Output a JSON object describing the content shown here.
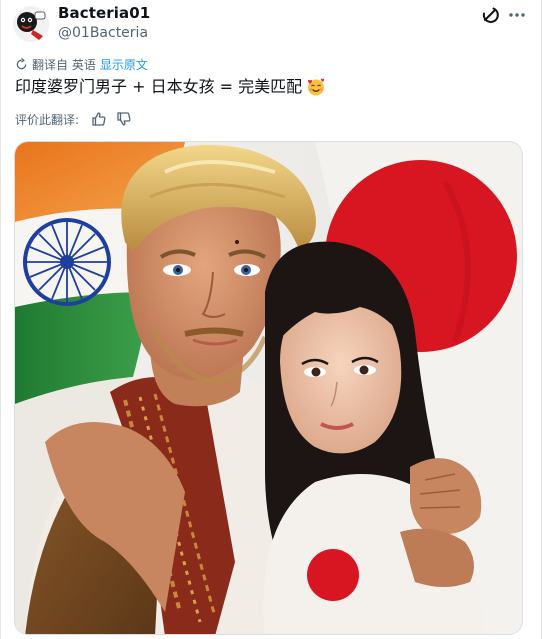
{
  "author": {
    "display_name": "Bacteria01",
    "handle": "@01Bacteria"
  },
  "translation": {
    "label": "翻译自 英语",
    "show_original": "显示原文"
  },
  "tweet": {
    "text": "印度婆罗门男子 + 日本女孩 = 完美匹配"
  },
  "rating": {
    "label": "评价此翻译:"
  },
  "colors": {
    "text_primary": "#0f1419",
    "text_secondary": "#536471",
    "link_blue": "#1d9bf0",
    "saffron": "#f0892a",
    "india_green": "#2e8b3a",
    "chakra_blue": "#1f3f9e",
    "japan_red": "#d81622"
  },
  "icons": {
    "avatar": "cartoon-avatar",
    "grok": "grok-icon",
    "more": "more-icon",
    "translate": "translate-icon",
    "thumb_up": "thumbs-up-icon",
    "thumb_down": "thumbs-down-icon",
    "emoji": "smiling-face-with-hearts-emoji"
  }
}
